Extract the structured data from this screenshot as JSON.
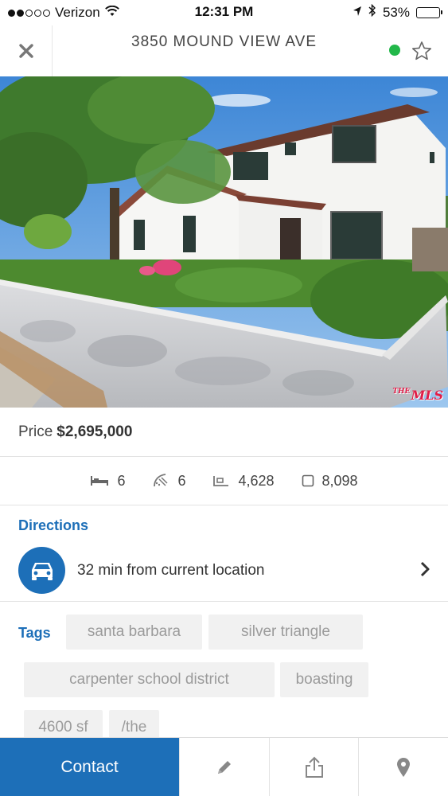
{
  "status_bar": {
    "carrier": "Verizon",
    "time": "12:31 PM",
    "battery": "53%",
    "battery_level": 0.53
  },
  "nav": {
    "title": "3850 MOUND VIEW AVE",
    "status_color": "#22b84a"
  },
  "hero": {
    "mls_badge": "MLS",
    "mls_prefix": "THE"
  },
  "price": {
    "label": "Price",
    "value": "$2,695,000"
  },
  "stats": {
    "beds": "6",
    "baths": "6",
    "sqft": "4,628",
    "lot": "8,098"
  },
  "directions": {
    "label": "Directions",
    "text": "32 min from current location"
  },
  "tags": {
    "label": "Tags",
    "items": [
      "santa barbara",
      "silver triangle",
      "carpenter school district",
      "boasting",
      "4600 sf",
      "/the"
    ]
  },
  "toolbar": {
    "contact_label": "Contact"
  },
  "colors": {
    "accent": "#1d6fb8",
    "tag_bg": "#f1f1f1",
    "tag_text": "#9b9b9b"
  },
  "icons": [
    "signal-dots-icon",
    "wifi-icon",
    "location-arrow-icon",
    "bluetooth-icon",
    "battery-icon",
    "close-icon",
    "star-icon",
    "bed-icon",
    "bath-icon",
    "sqft-icon",
    "lot-icon",
    "car-icon",
    "chevron-right-icon",
    "pencil-icon",
    "share-icon",
    "map-pin-icon"
  ]
}
